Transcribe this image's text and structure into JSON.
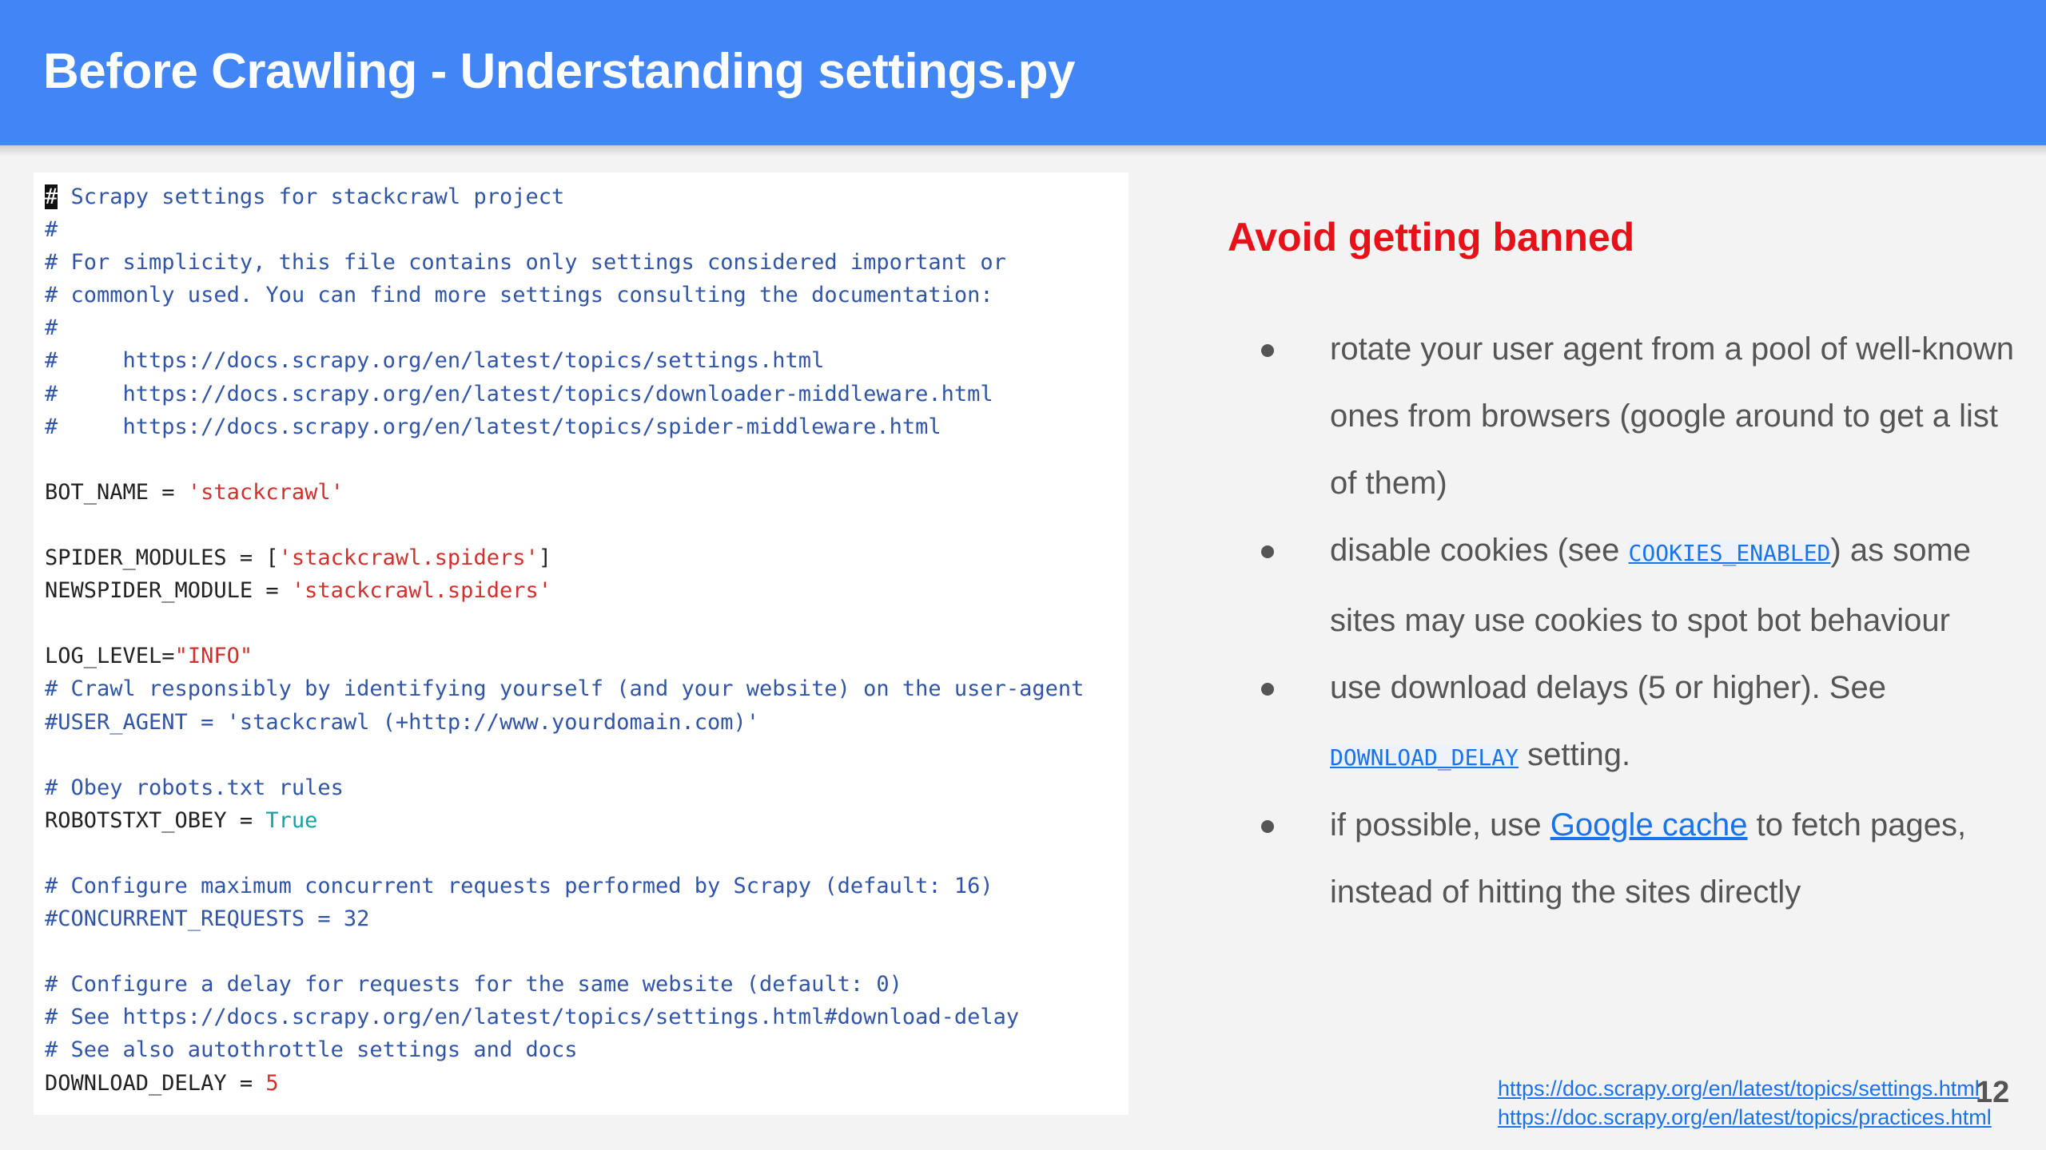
{
  "slide": {
    "title": "Before Crawling - Understanding settings.py",
    "page_number": "12",
    "header_color": "#4285f4"
  },
  "code": {
    "lines": [
      {
        "segments": [
          {
            "type": "cursor",
            "text": "#"
          },
          {
            "type": "comment",
            "text": " Scrapy settings for stackcrawl project"
          }
        ]
      },
      {
        "segments": [
          {
            "type": "comment",
            "text": "#"
          }
        ]
      },
      {
        "segments": [
          {
            "type": "comment",
            "text": "# For simplicity, this file contains only settings considered important or"
          }
        ]
      },
      {
        "segments": [
          {
            "type": "comment",
            "text": "# commonly used. You can find more settings consulting the documentation:"
          }
        ]
      },
      {
        "segments": [
          {
            "type": "comment",
            "text": "#"
          }
        ]
      },
      {
        "segments": [
          {
            "type": "comment",
            "text": "#     https://docs.scrapy.org/en/latest/topics/settings.html"
          }
        ]
      },
      {
        "segments": [
          {
            "type": "comment",
            "text": "#     https://docs.scrapy.org/en/latest/topics/downloader-middleware.html"
          }
        ]
      },
      {
        "segments": [
          {
            "type": "comment",
            "text": "#     https://docs.scrapy.org/en/latest/topics/spider-middleware.html"
          }
        ]
      },
      {
        "segments": []
      },
      {
        "segments": [
          {
            "type": "plain",
            "text": "BOT_NAME = "
          },
          {
            "type": "str",
            "text": "'stackcrawl'"
          }
        ]
      },
      {
        "segments": []
      },
      {
        "segments": [
          {
            "type": "plain",
            "text": "SPIDER_MODULES = ["
          },
          {
            "type": "str",
            "text": "'stackcrawl.spiders'"
          },
          {
            "type": "plain",
            "text": "]"
          }
        ]
      },
      {
        "segments": [
          {
            "type": "plain",
            "text": "NEWSPIDER_MODULE = "
          },
          {
            "type": "str",
            "text": "'stackcrawl.spiders'"
          }
        ]
      },
      {
        "segments": []
      },
      {
        "segments": [
          {
            "type": "plain",
            "text": "LOG_LEVEL="
          },
          {
            "type": "str",
            "text": "\"INFO\""
          }
        ]
      },
      {
        "segments": [
          {
            "type": "comment",
            "text": "# Crawl responsibly by identifying yourself (and your website) on the user-agent"
          }
        ]
      },
      {
        "segments": [
          {
            "type": "comment",
            "text": "#USER_AGENT = 'stackcrawl (+http://www.yourdomain.com)'"
          }
        ]
      },
      {
        "segments": []
      },
      {
        "segments": [
          {
            "type": "comment",
            "text": "# Obey robots.txt rules"
          }
        ]
      },
      {
        "segments": [
          {
            "type": "plain",
            "text": "ROBOTSTXT_OBEY = "
          },
          {
            "type": "kw",
            "text": "True"
          }
        ]
      },
      {
        "segments": []
      },
      {
        "segments": [
          {
            "type": "comment",
            "text": "# Configure maximum concurrent requests performed by Scrapy (default: 16)"
          }
        ]
      },
      {
        "segments": [
          {
            "type": "comment",
            "text": "#CONCURRENT_REQUESTS = 32"
          }
        ]
      },
      {
        "segments": []
      },
      {
        "segments": [
          {
            "type": "comment",
            "text": "# Configure a delay for requests for the same website (default: 0)"
          }
        ]
      },
      {
        "segments": [
          {
            "type": "comment",
            "text": "# See https://docs.scrapy.org/en/latest/topics/settings.html#download-delay"
          }
        ]
      },
      {
        "segments": [
          {
            "type": "comment",
            "text": "# See also autothrottle settings and docs"
          }
        ]
      },
      {
        "segments": [
          {
            "type": "plain",
            "text": "DOWNLOAD_DELAY = "
          },
          {
            "type": "num",
            "text": "5"
          }
        ]
      }
    ]
  },
  "tips": {
    "heading": "Avoid getting banned",
    "bullets": [
      {
        "segments": [
          {
            "type": "text",
            "text": "rotate your user agent from a pool of well-known ones from browsers (google around to get a list of them)"
          }
        ]
      },
      {
        "segments": [
          {
            "type": "text",
            "text": "disable cookies (see "
          },
          {
            "type": "mono-link",
            "text": "COOKIES_ENABLED"
          },
          {
            "type": "text",
            "text": ") as some sites may use cookies to spot bot behaviour"
          }
        ]
      },
      {
        "segments": [
          {
            "type": "text",
            "text": "use download delays (5 or higher). See "
          },
          {
            "type": "mono-link",
            "text": "DOWNLOAD_DELAY"
          },
          {
            "type": "text",
            "text": " setting."
          }
        ]
      },
      {
        "segments": [
          {
            "type": "text",
            "text": "if possible, use "
          },
          {
            "type": "link",
            "text": "Google cache"
          },
          {
            "type": "text",
            "text": " to fetch pages, instead of hitting the sites directly"
          }
        ]
      }
    ]
  },
  "references": [
    "https://doc.scrapy.org/en/latest/topics/settings.html",
    "https://doc.scrapy.org/en/latest/topics/practices.html"
  ]
}
